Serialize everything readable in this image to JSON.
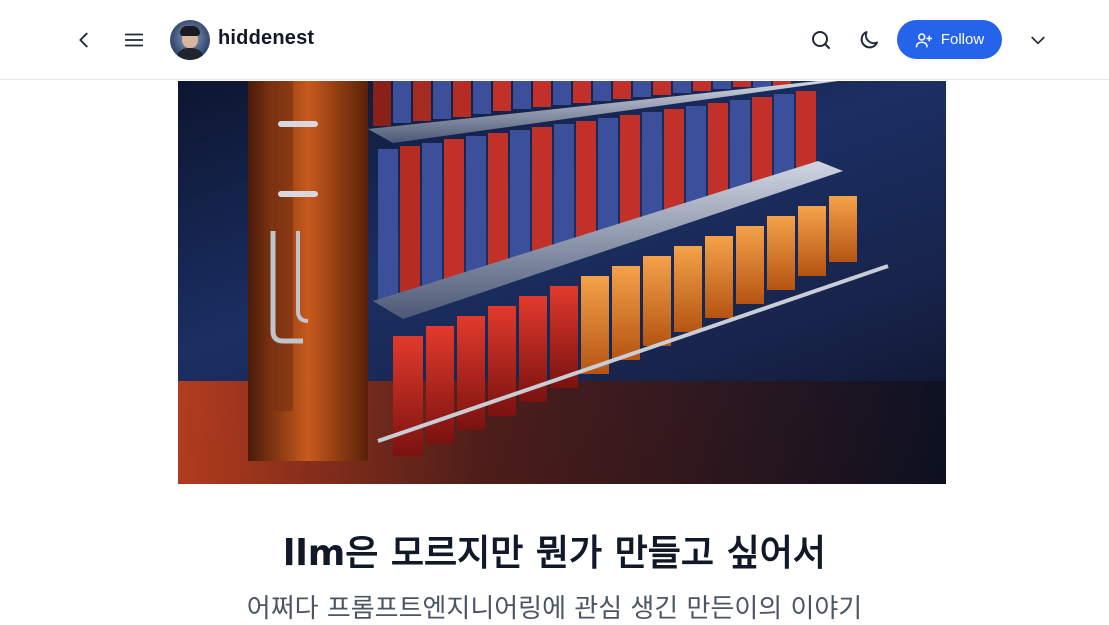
{
  "header": {
    "blog_name": "hiddenest",
    "follow_label": "Follow",
    "icons": {
      "back": "chevron-left-icon",
      "menu": "hamburger-menu-icon",
      "search": "search-icon",
      "theme": "moon-icon",
      "follow": "user-plus-icon",
      "more": "chevron-down-icon"
    }
  },
  "post": {
    "title": "llm은 모르지만 뭔가 만들고 싶어서",
    "subtitle": "어쩌다 프롬프트엔지니어링에 관심 생긴 만든이의 이야기"
  },
  "colors": {
    "accent": "#2563eb",
    "header_border": "#e5e7eb",
    "title_text": "#111827"
  }
}
